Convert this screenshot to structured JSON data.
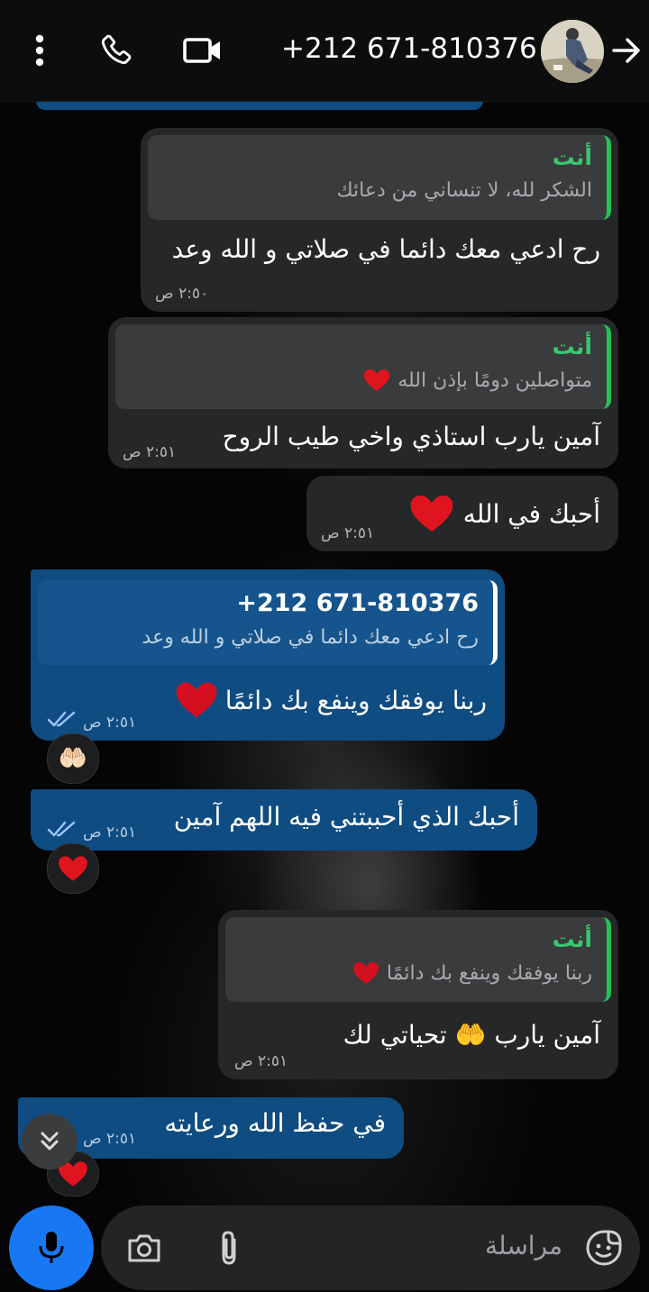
{
  "header": {
    "contact": "+212 671-810376",
    "icons": [
      "more-vert-icon",
      "phone-icon",
      "video-call-icon",
      "avatar",
      "back-arrow-icon"
    ]
  },
  "messages": {
    "m1": {
      "quote_name": "أنت",
      "quote_text": "الشكر لله، لا تنساني من دعائك",
      "text": "رح ادعي معك دائما في صلاتي و الله وعد",
      "time": "٢:٥٠ ص"
    },
    "m2": {
      "quote_name": "أنت",
      "quote_text": "متواصلين دومًا بإذن الله",
      "text": "آمين يارب استاذي واخي طيب الروح",
      "time": "٢:٥١ ص"
    },
    "m3": {
      "text": "أحبك في الله",
      "time": "٢:٥١ ص"
    },
    "m4": {
      "quote_name": "+212 671-810376",
      "quote_text": "رح ادعي معك دائما في صلاتي و الله وعد",
      "text": "ربنا يوفقك وينفع بك دائمًا",
      "time": "٢:٥١ ص",
      "reaction": "🤲🏻"
    },
    "m5": {
      "text": "أحبك الذي أحببتني فيه اللهم آمين",
      "time": "٢:٥١ ص",
      "reaction": "❤️"
    },
    "m6": {
      "quote_name": "أنت",
      "quote_text": "ربنا يوفقك وينفع بك دائمًا",
      "text": "آمين يارب 🤲 تحياتي لك",
      "time": "٢:٥١ ص"
    },
    "m7": {
      "text": "في حفظ الله ورعايته",
      "time": "٢:٥١ ص",
      "reaction": "❤️"
    }
  },
  "composer": {
    "placeholder": "مراسلة",
    "icons": [
      "mic-icon",
      "camera-icon",
      "attach-icon",
      "sticker-icon"
    ]
  },
  "colors": {
    "incoming": "#262728",
    "outgoing": "#0f4c81",
    "accent": "#1877f2",
    "reply_bar": "#25c25a"
  }
}
